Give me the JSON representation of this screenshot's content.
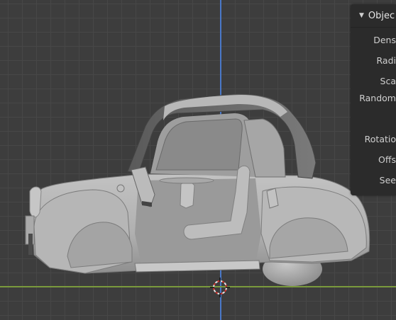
{
  "panel": {
    "title": "Objec",
    "properties": [
      {
        "label": "Dens"
      },
      {
        "label": "Radi"
      },
      {
        "label": "Sca"
      },
      {
        "label": "Random"
      },
      {
        "label": "Rotatio"
      },
      {
        "label": "Offs"
      },
      {
        "label": "See"
      }
    ]
  },
  "colors": {
    "viewport_bg": "#3d3d3d",
    "grid_line": "#474747",
    "axis_z": "#4a78c8",
    "axis_x": "#7a9a3c",
    "panel_bg": "#2b2b2b",
    "model_base": "#b4b4b4",
    "model_dark": "#555555"
  },
  "icons": [
    "collapse-triangle-icon",
    "3d-cursor-icon"
  ]
}
